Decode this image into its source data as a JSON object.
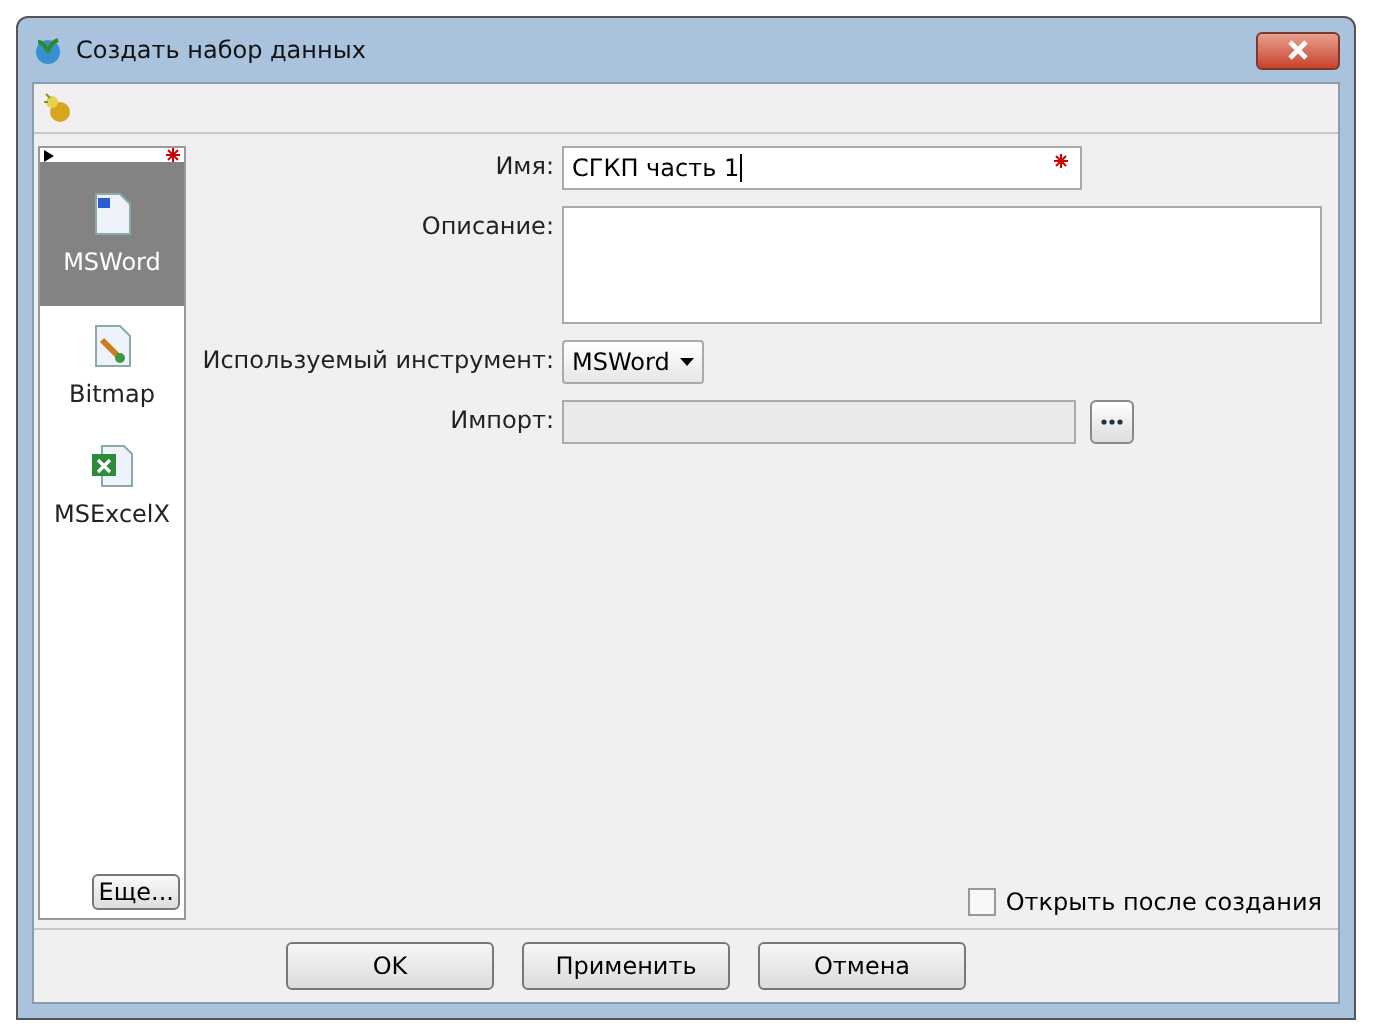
{
  "window": {
    "title": "Создать набор данных"
  },
  "tools": [
    {
      "label": "MSWord",
      "kind": "word",
      "selected": true
    },
    {
      "label": "Bitmap",
      "kind": "bitmap",
      "selected": false
    },
    {
      "label": "MSExcelX",
      "kind": "excel",
      "selected": false
    }
  ],
  "more_button": "Еще...",
  "form": {
    "name": {
      "label": "Имя:",
      "value": "СГКП часть 1",
      "required": true
    },
    "description": {
      "label": "Описание:"
    },
    "tool": {
      "label": "Используемый инструмент:",
      "value": "MSWord"
    },
    "import": {
      "label": "Импорт:",
      "disabled": true
    }
  },
  "open_after": {
    "label": "Открыть после создания",
    "checked": false
  },
  "buttons": [
    "OK",
    "Применить",
    "Отмена"
  ]
}
